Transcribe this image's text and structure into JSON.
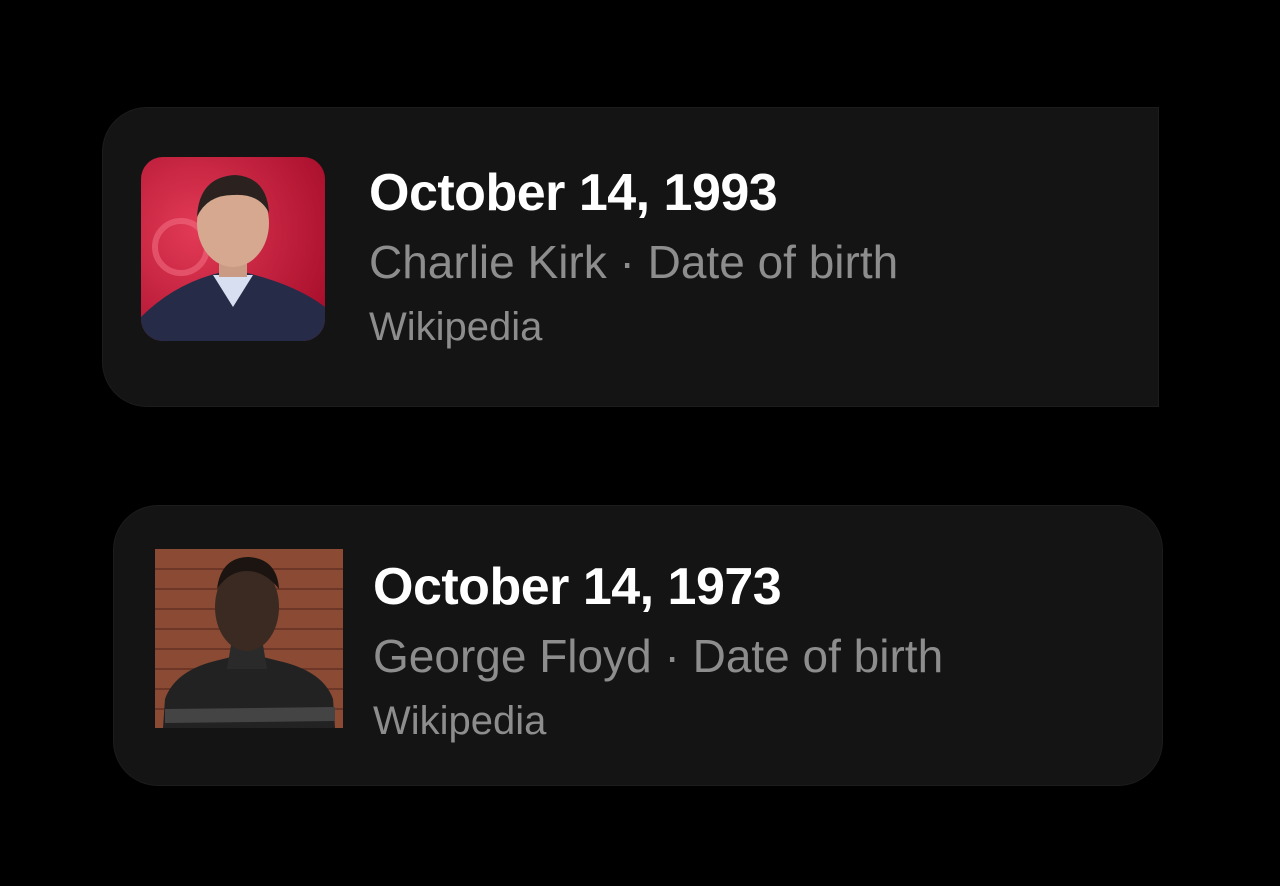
{
  "results": [
    {
      "date": "October 14, 1993",
      "name": "Charlie Kirk",
      "separator": "·",
      "attribute": "Date of birth",
      "source": "Wikipedia",
      "photo_icon": "person-photo-icon"
    },
    {
      "date": "October 14, 1973",
      "name": "George Floyd",
      "separator": "·",
      "attribute": "Date of birth",
      "source": "Wikipedia",
      "photo_icon": "person-photo-icon"
    }
  ],
  "colors": {
    "background": "#000000",
    "card": "#141414",
    "title": "#ffffff",
    "secondary": "#8d8d8d"
  }
}
